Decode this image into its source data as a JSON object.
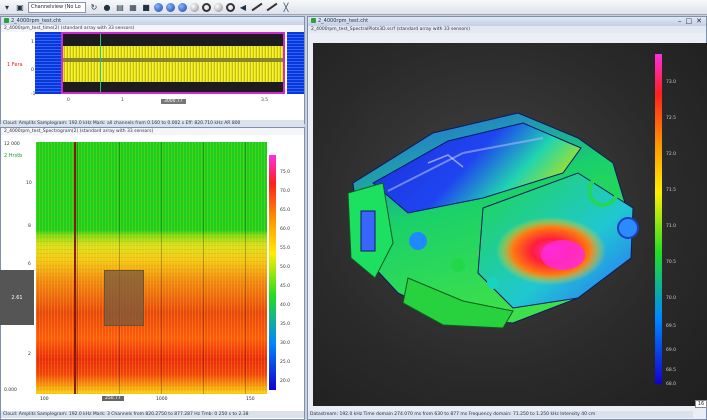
{
  "toolbar": {
    "view_select": "Channelview (No Lo",
    "zoom_value": "16"
  },
  "left_top": {
    "title": "2_4000rpm_test.cht",
    "subtitle": "2_4000rpm_test_time(2) (standard array with 33 sensors)",
    "y_label": "1 Fera",
    "y_ticks": [
      "1",
      "0",
      "-1"
    ],
    "x_ticks": [
      "0",
      "1",
      "3.5"
    ],
    "x_box": "3000.77",
    "status": "Cloud: Amplits  Samplegram: 192.0 kHz  Mark: all channels from 0.160 to 0.002 s  Eff: 820.710 kHz  AR 800"
  },
  "left_bottom": {
    "subtitle": "2_4000rpm_test_Spectrogram(2) (standard array with 33 sensors)",
    "top_label": "2 Hrstb",
    "y_ticks": [
      "12 000",
      "10",
      "8",
      "6",
      "4",
      "2",
      "0.000"
    ],
    "y_box": "2.61",
    "x_ticks": [
      "100",
      "250.77",
      "1000",
      "150"
    ],
    "colorbar_ticks": [
      "75.0",
      "70.0",
      "65.0",
      "60.0",
      "55.0",
      "50.0",
      "45.0",
      "40.0",
      "35.0",
      "30.0",
      "25.0",
      "20.0"
    ],
    "status": "Cloud: Amplits  Samplegram: 192.0 kHz  Mark: 3 Channels from 820.2750 to 877.287 Hz  Tmb: 0 250 s to 2.38"
  },
  "right": {
    "title": "2_4000rpm_test.cht",
    "subtitle": "2_4000rpm_test_SpectralPlots3D.ssrf (standard array with 33 sensors)",
    "colorbar_ticks": [
      "73.0",
      "72.5",
      "72.0",
      "71.5",
      "71.0",
      "70.5",
      "70.0",
      "69.5",
      "69.0",
      "68.5",
      "68.0"
    ],
    "status": "Datastream: 192.0 kHz  Time domain 274.070 ms from 630 to 877 ms  Frequency domain: 71.250 to 1.250 kHz  Intensity 40 cm"
  },
  "colors": {
    "wave_frame": "#d128d6",
    "spec_red": "#e84512",
    "engine_blue": "#1833e0",
    "engine_green": "#22d24a"
  }
}
